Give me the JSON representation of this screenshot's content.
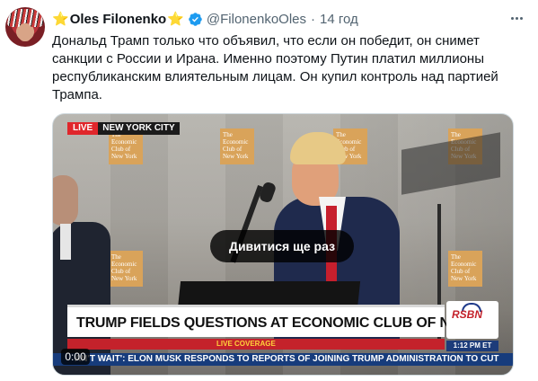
{
  "tweet": {
    "author_name": "Oles Filonenko",
    "author_prefix_emoji": "⭐",
    "author_suffix_emoji": "⭐",
    "handle": "@FilonenkoOles",
    "separator": "·",
    "time": "14 год",
    "text": "Дональд Трамп только что объявил, что если он победит, он снимет санкции с России и Ирана. Именно поэтому Путин платил миллионы республиканским влиятельным лицам. Он купил контроль над партией Трампа."
  },
  "video": {
    "live_label": "LIVE",
    "location_label": "NEW YORK CITY",
    "overlay_button": "Дивитися ще раз",
    "headline": "TRUMP FIELDS QUESTIONS AT ECONOMIC CLUB OF NY",
    "live_coverage": "LIVE COVERAGE",
    "network": "RSBN",
    "clock": "1:12 PM ET",
    "ticker": "AN'T WAIT': ELON MUSK RESPONDS TO REPORTS OF JOINING TRUMP ADMINISTRATION TO CUT",
    "timecode": "0:00",
    "backdrop_logo": "The Economic Club of New York"
  },
  "colors": {
    "accent_blue": "#1d9bf0",
    "live_red": "#e0262b",
    "star_gold": "#f2b01e",
    "ticker_blue": "#173c7c"
  },
  "icons": {
    "verified": "verified-badge-icon",
    "more": "more-options-icon"
  }
}
